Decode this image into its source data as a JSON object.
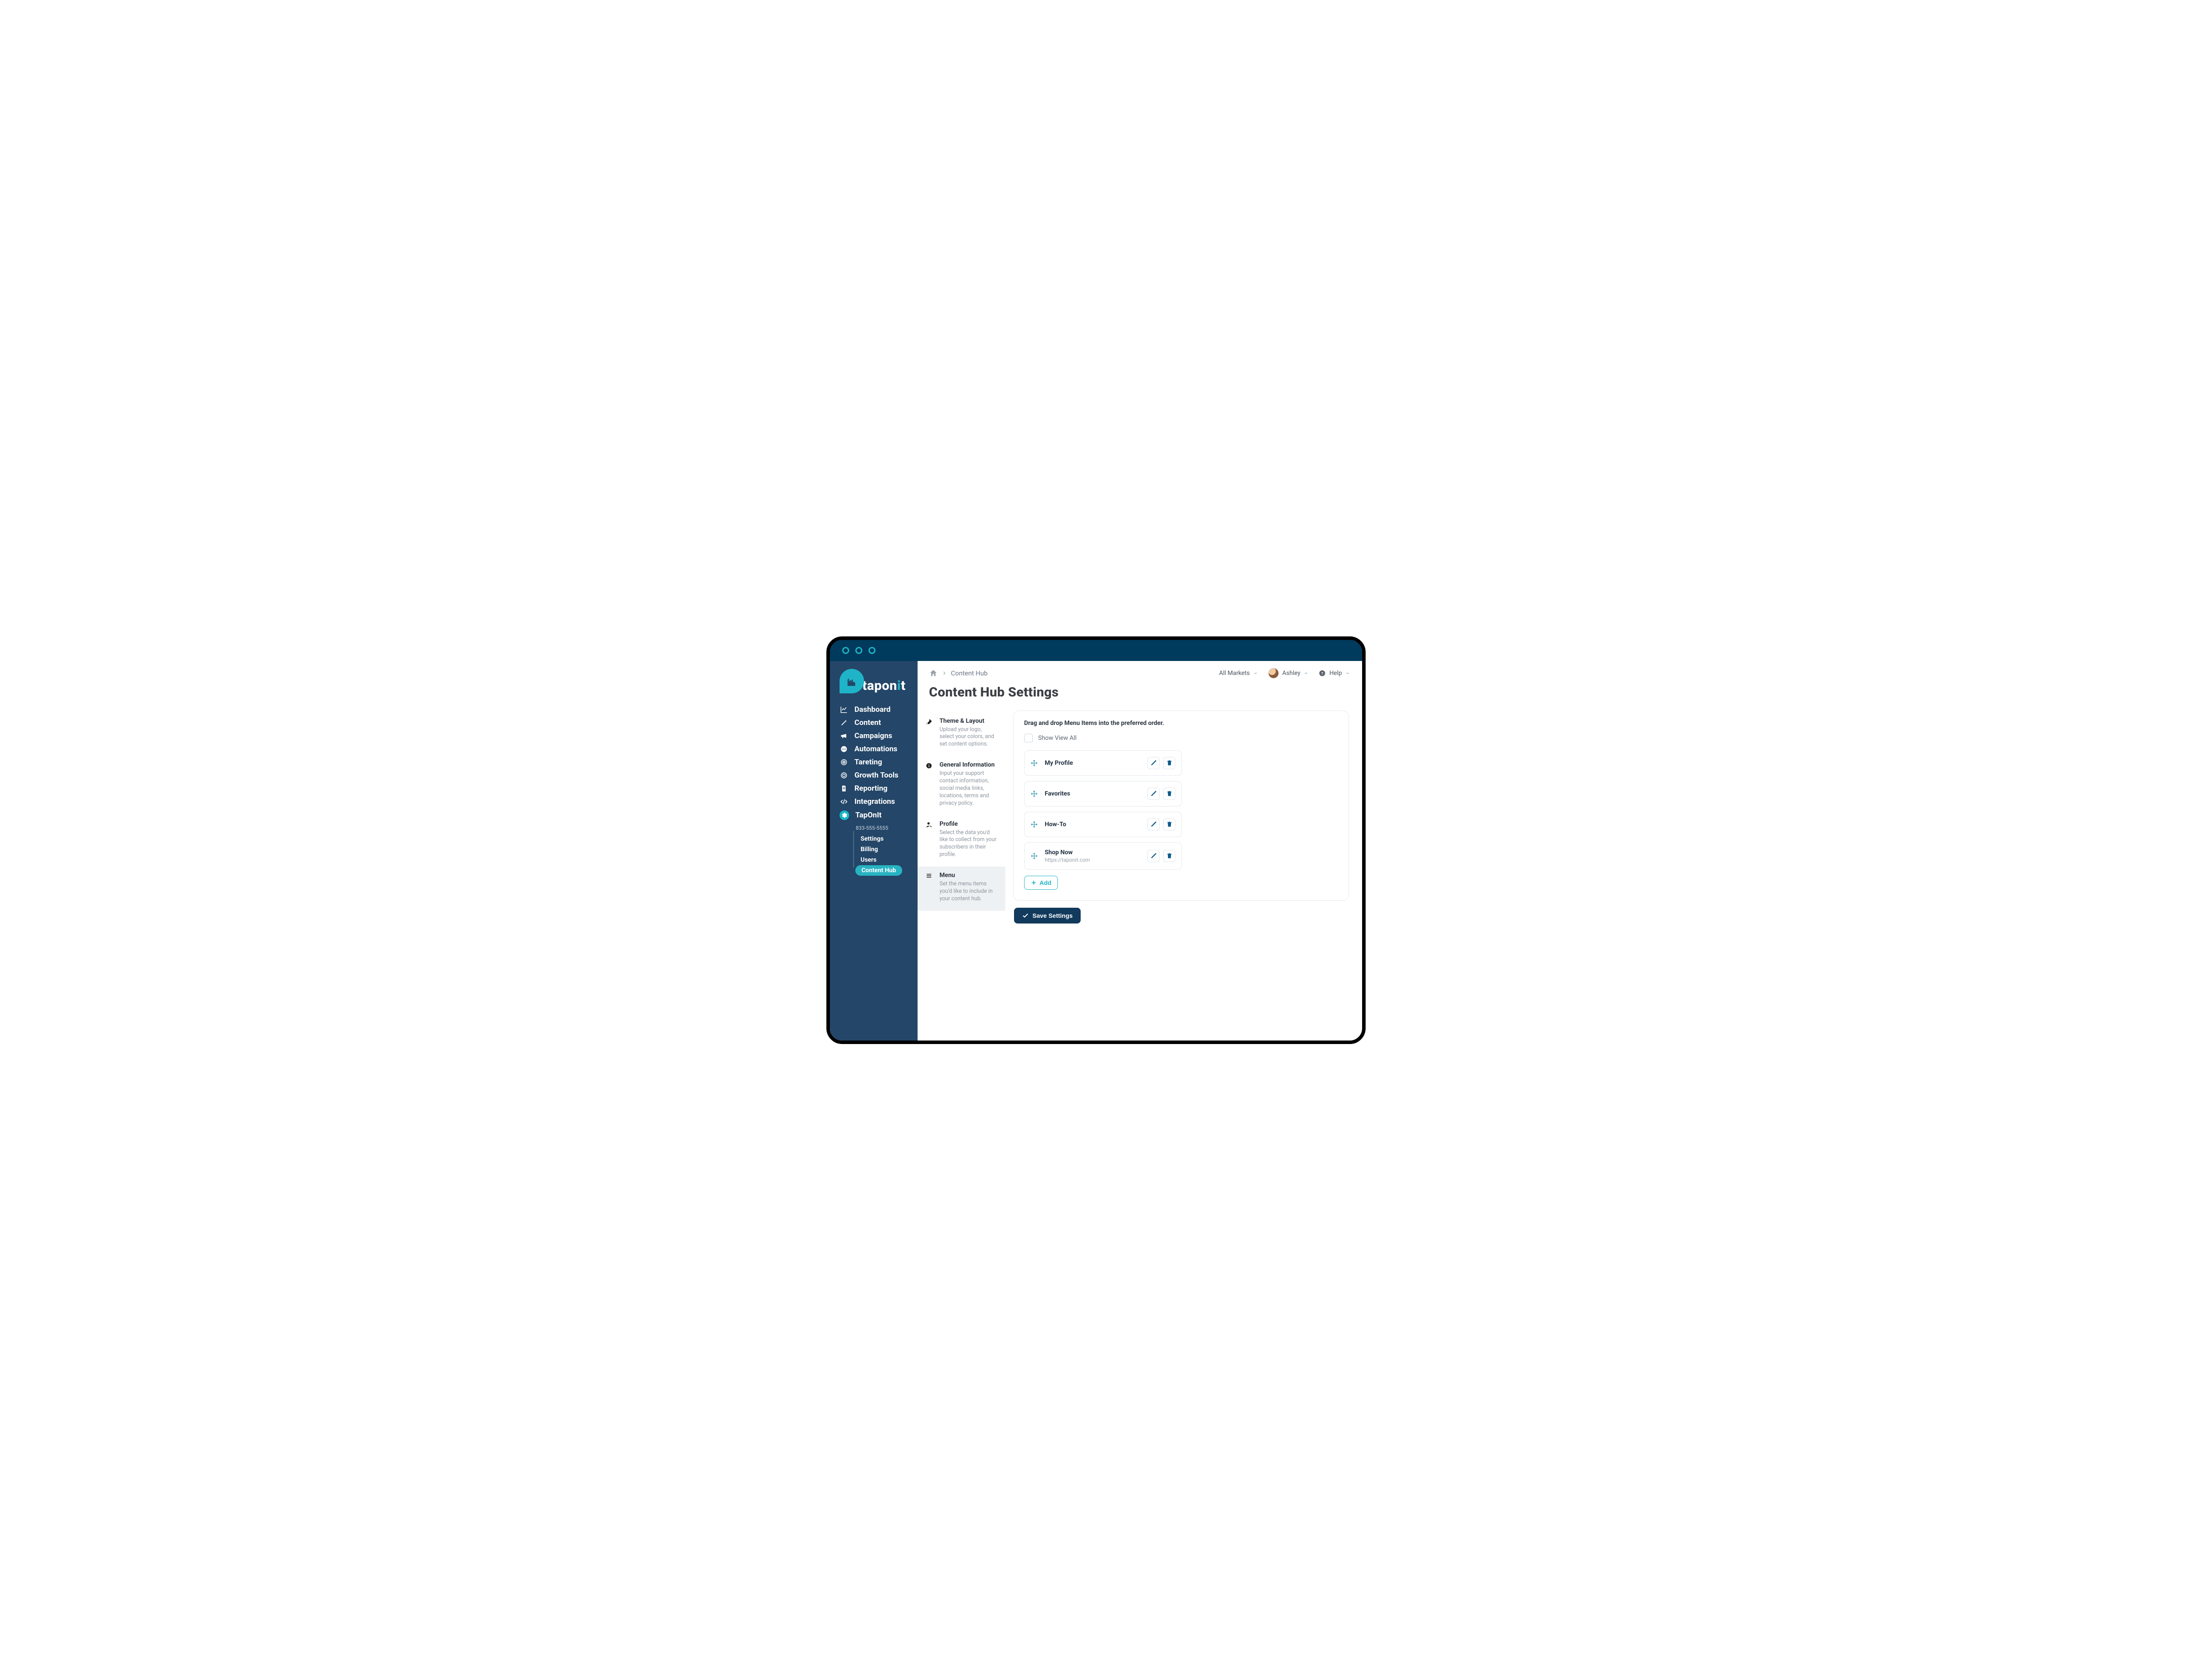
{
  "brand": {
    "name": "taponit"
  },
  "header": {
    "breadcrumb": "Content Hub",
    "markets_label": "All Markets",
    "user_name": "Ashley",
    "help_label": "Help"
  },
  "page": {
    "title": "Content Hub Settings"
  },
  "sidebar": {
    "items": [
      {
        "label": "Dashboard"
      },
      {
        "label": "Content"
      },
      {
        "label": "Campaigns"
      },
      {
        "label": "Automations"
      },
      {
        "label": "Tareting"
      },
      {
        "label": "Growth Tools"
      },
      {
        "label": "Reporting"
      },
      {
        "label": "Integrations"
      }
    ],
    "account": {
      "label": "TapOnIt",
      "phone": "833-555-5555",
      "children": [
        {
          "label": "Settings"
        },
        {
          "label": "Billing"
        },
        {
          "label": "Users"
        },
        {
          "label": "Content Hub",
          "active": true
        }
      ]
    }
  },
  "subnav": [
    {
      "title": "Theme & Layout",
      "desc": "Upload your logo, select your colors, and set content options."
    },
    {
      "title": "General Information",
      "desc": "Input your support contact information, social media links, locations, terms and privacy policy."
    },
    {
      "title": "Profile",
      "desc": "Select the data you'd like to collect from your subscribers in their profile."
    },
    {
      "title": "Menu",
      "desc": "Set the menu items you'd like to include in your content hub.",
      "active": true
    }
  ],
  "panel": {
    "instruction": "Drag and drop Menu Items into the preferred order.",
    "show_all_label": "Show View All",
    "menu_items": [
      {
        "label": "My Profile"
      },
      {
        "label": "Favorites"
      },
      {
        "label": "How-To"
      },
      {
        "label": "Shop Now",
        "url": "https://taponit.com"
      }
    ],
    "add_label": "Add",
    "save_label": "Save Settings"
  }
}
